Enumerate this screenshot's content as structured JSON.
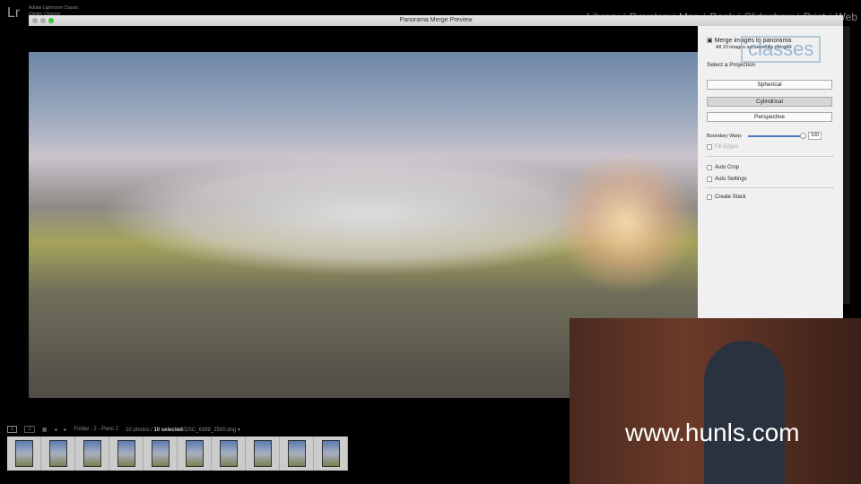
{
  "app": {
    "logo": "Lr",
    "name": "Adobe Lightroom Classic",
    "subtitle": "Dimitry Chernyy"
  },
  "modules": [
    "Library",
    "Develop",
    "Map",
    "Book",
    "Slideshow",
    "Print",
    "Web"
  ],
  "dialog": {
    "title": "Panorama Merge Preview"
  },
  "panel": {
    "heading": "Merge images to panorama",
    "status": "All 10 images successfully merged",
    "projection_label": "Select a Projection",
    "projections": [
      "Spherical",
      "Cylindrical",
      "Perspective"
    ],
    "selected": "Cylindrical",
    "boundary_warp_label": "Boundary Warp:",
    "boundary_warp_value": "100",
    "boundary_warp_fraction": 1.0,
    "fill_edges": "Fill Edges",
    "auto_crop": "Auto Crop",
    "auto_settings": "Auto Settings",
    "create_stack": "Create Stack"
  },
  "filmstrip": {
    "view1": "1",
    "view2": "2",
    "source": "Folder : 2 - Pano 2",
    "count": "10 photos /",
    "selected": "10 selected",
    "file": "/DSC_6399_2500.dng",
    "thumbs": [
      "1",
      "2",
      "3",
      "4",
      "5",
      "6",
      "7",
      "8",
      "9",
      "10"
    ]
  },
  "overlay": {
    "watermark": "www.hunls.com",
    "classes": "classes"
  }
}
